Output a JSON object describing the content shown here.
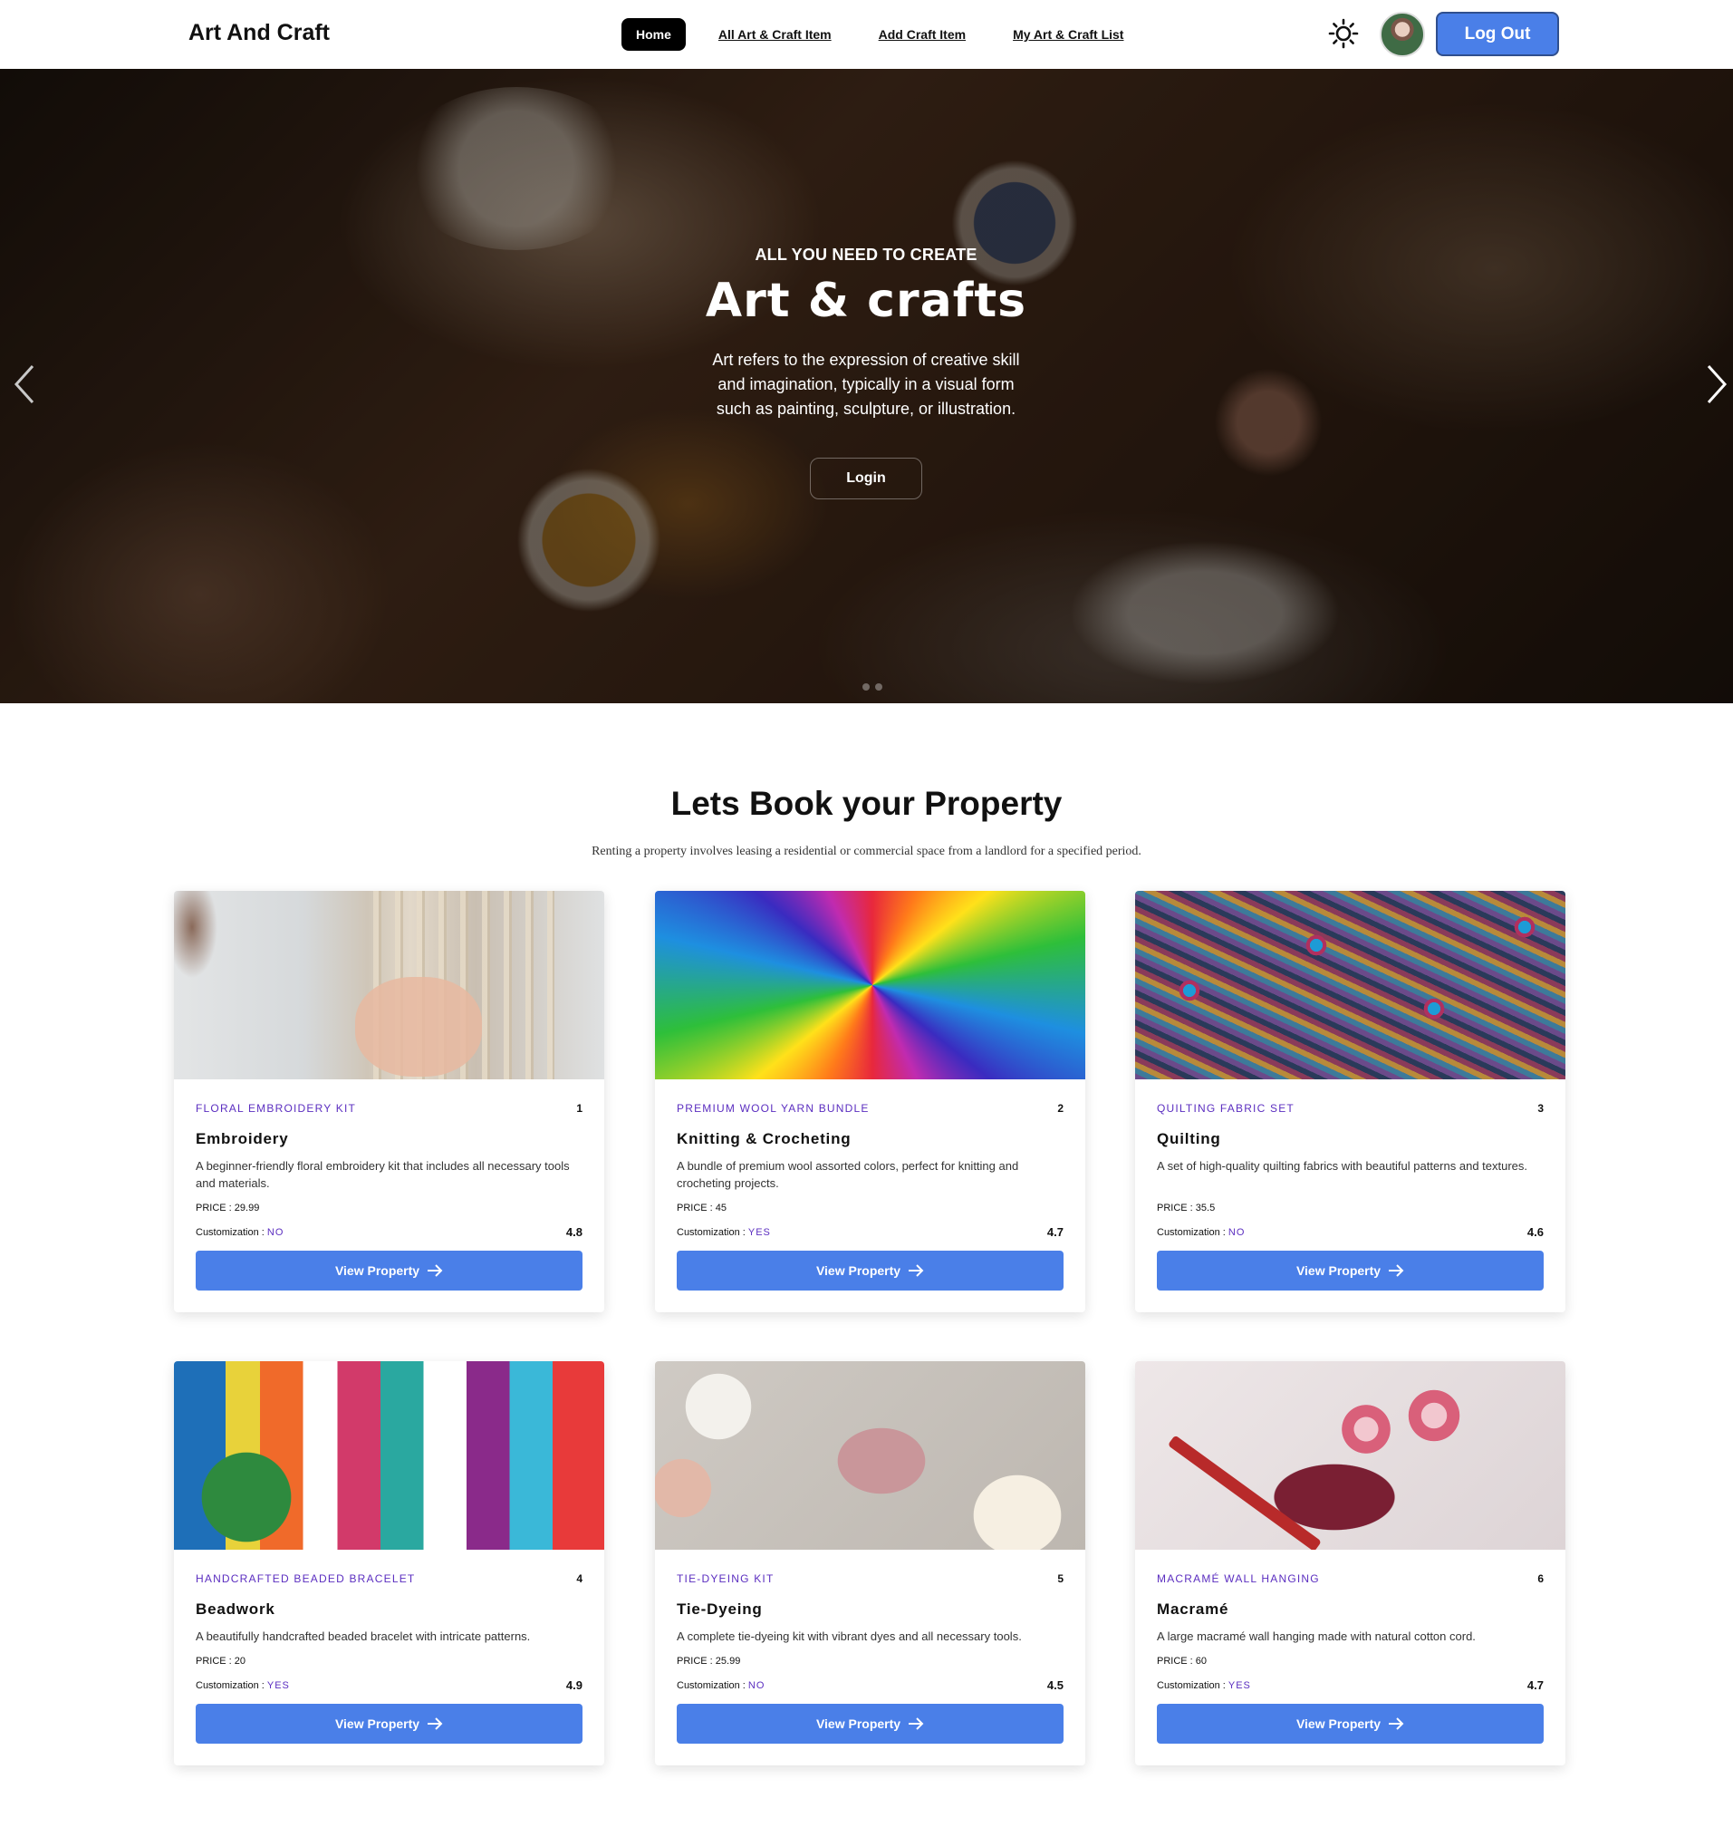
{
  "navbar": {
    "brand": "Art And Craft",
    "links": [
      "Home",
      "All Art & Craft Item",
      "Add Craft Item",
      "My Art & Craft List"
    ],
    "active_link": "Home",
    "theme_icon": "sun-icon",
    "logout_label": "Log Out"
  },
  "hero": {
    "kicker": "ALL YOU NEED TO CREATE",
    "title": "Art & crafts",
    "text": "Art refers to the expression of creative skill and imagination, typically in a visual form such as painting, sculpture, or illustration.",
    "cta_label": "Login",
    "prev_icon": "chevron-left-icon",
    "next_icon": "chevron-right-icon"
  },
  "section": {
    "title": "Lets Book your Property",
    "subtitle": "Renting a property involves leasing a residential or commercial space from a landlord for a specified period."
  },
  "labels": {
    "price_prefix": "PRICE : ",
    "customization_prefix": "Customization : ",
    "button": "View Property"
  },
  "cards": [
    {
      "item_name": "FLORAL EMBROIDERY KIT",
      "id": "1",
      "subcategory": "Embroidery",
      "description": "A beginner-friendly floral embroidery kit that includes all necessary tools and materials.",
      "price": "29.99",
      "customization": "NO",
      "rating": "4.8"
    },
    {
      "item_name": "PREMIUM WOOL YARN BUNDLE",
      "id": "2",
      "subcategory": "Knitting & Crocheting",
      "description": "A bundle of premium wool assorted colors, perfect for knitting and crocheting projects.",
      "price": "45",
      "customization": "YES",
      "rating": "4.7"
    },
    {
      "item_name": "QUILTING FABRIC SET",
      "id": "3",
      "subcategory": "Quilting",
      "description": "A set of high-quality quilting fabrics with beautiful patterns and textures.",
      "price": "35.5",
      "customization": "NO",
      "rating": "4.6"
    },
    {
      "item_name": "HANDCRAFTED BEADED BRACELET",
      "id": "4",
      "subcategory": "Beadwork",
      "description": "A beautifully handcrafted beaded bracelet with intricate patterns.",
      "price": "20",
      "customization": "YES",
      "rating": "4.9"
    },
    {
      "item_name": "TIE-DYEING KIT",
      "id": "5",
      "subcategory": "Tie-Dyeing",
      "description": "A complete tie-dyeing kit with vibrant dyes and all necessary tools.",
      "price": "25.99",
      "customization": "NO",
      "rating": "4.5"
    },
    {
      "item_name": "MACRAMÉ WALL HANGING",
      "id": "6",
      "subcategory": "Macramé",
      "description": "A large macramé wall hanging made with natural cotton cord.",
      "price": "60",
      "customization": "YES",
      "rating": "4.7"
    }
  ],
  "colors": {
    "accent": "#4a7fe8",
    "purple": "#5b2ec0",
    "nav_active": "#000000"
  }
}
